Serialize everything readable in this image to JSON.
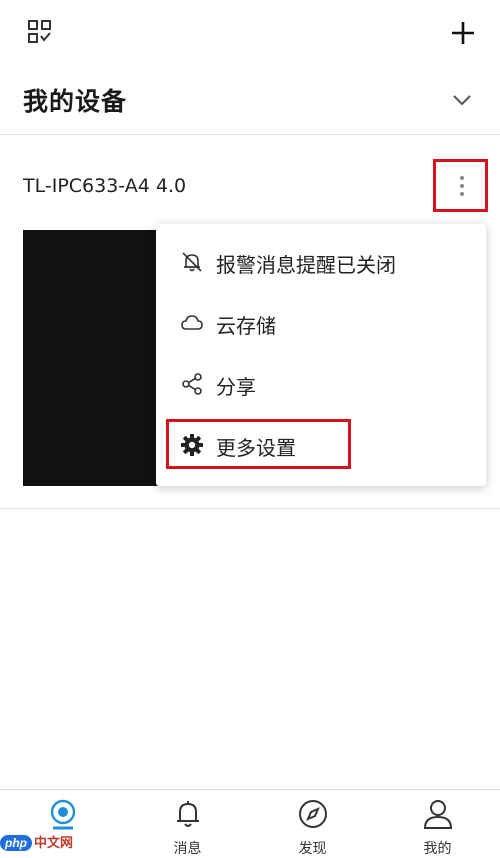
{
  "header": {
    "title": "我的设备"
  },
  "device": {
    "name": "TL-IPC633-A4 4.0"
  },
  "menu": {
    "items": [
      {
        "label": "报警消息提醒已关闭",
        "icon": "bell-off-icon"
      },
      {
        "label": "云存储",
        "icon": "cloud-icon"
      },
      {
        "label": "分享",
        "icon": "share-icon"
      },
      {
        "label": "更多设置",
        "icon": "gear-icon"
      }
    ]
  },
  "tabs": [
    {
      "label": "",
      "icon": "camera-icon",
      "active": true
    },
    {
      "label": "消息",
      "icon": "bell-icon"
    },
    {
      "label": "发现",
      "icon": "compass-icon"
    },
    {
      "label": "我的",
      "icon": "person-icon"
    }
  ],
  "watermark": {
    "text_a": "php",
    "text_b": "中文网"
  },
  "colors": {
    "accent": "#1e90d8",
    "highlight": "#d9121f"
  }
}
